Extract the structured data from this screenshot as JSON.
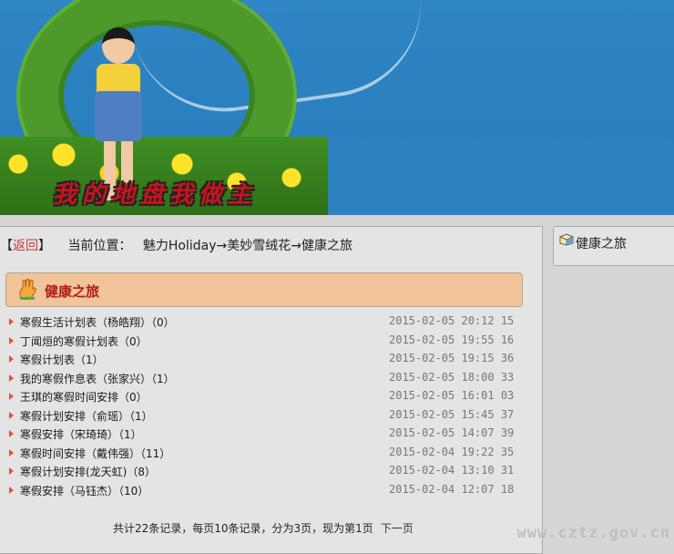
{
  "banner": {
    "title": "我的地盘我做主"
  },
  "breadcrumb": {
    "open": "【",
    "back": "返回",
    "close": "】",
    "location_label": "当前位置：",
    "path": "魅力Holiday→美妙雪绒花→健康之旅"
  },
  "section": {
    "title": "健康之旅"
  },
  "articles": [
    {
      "title": "寒假生活计划表（杨皓翔）（0）",
      "date": "2015-02-05 20:12 15"
    },
    {
      "title": "丁闻烜的寒假计划表（0）",
      "date": "2015-02-05 19:55 16"
    },
    {
      "title": "寒假计划表（1）",
      "date": "2015-02-05 19:15 36"
    },
    {
      "title": "我的寒假作息表（张家兴）（1）",
      "date": "2015-02-05 18:00 33"
    },
    {
      "title": "王琪的寒假时间安排（0）",
      "date": "2015-02-05 16:01 03"
    },
    {
      "title": "寒假计划安排（俞瑶）（1）",
      "date": "2015-02-05 15:45 37"
    },
    {
      "title": "寒假安排（宋琦琦）（1）",
      "date": "2015-02-05 14:07 39"
    },
    {
      "title": "寒假时间安排（戴伟强）（11）",
      "date": "2015-02-04 19:22 35"
    },
    {
      "title": "寒假计划安排(龙天虹)（8）",
      "date": "2015-02-04 13:10 31"
    },
    {
      "title": "寒假安排（马钰杰）（10）",
      "date": "2015-02-04 12:07 18"
    }
  ],
  "pager": {
    "summary": "共计22条记录，每页10条记录，分为3页，现为第1页",
    "next": "下一页"
  },
  "sidebar": {
    "title": "健康之旅"
  },
  "watermark": "www.cztz.gov.cn",
  "colors": {
    "accent": "#c23b3b",
    "section_bg": "#f1c49a",
    "banner_bg": "#2f86c4"
  }
}
